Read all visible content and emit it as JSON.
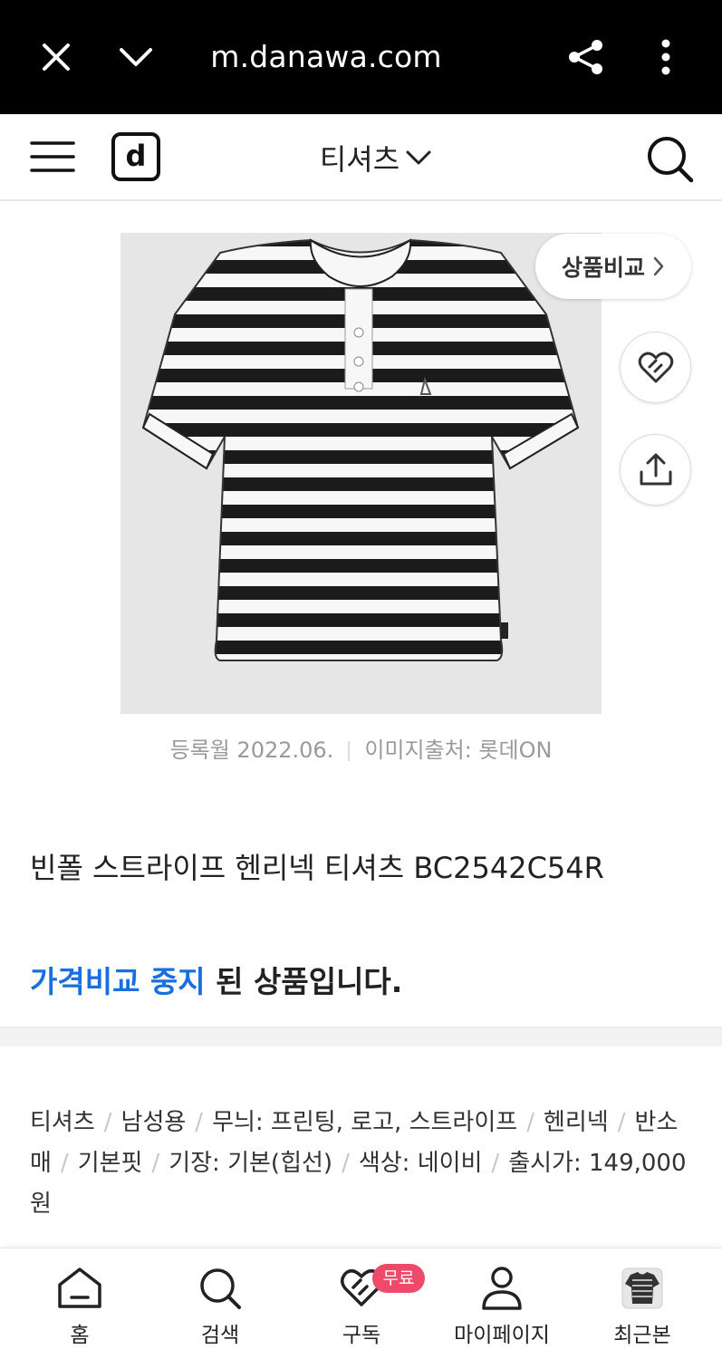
{
  "browser": {
    "url": "m.danawa.com",
    "icons": [
      "close-icon",
      "chevron-down-icon",
      "share-icon",
      "more-vertical-icon"
    ]
  },
  "header": {
    "logo": "d",
    "category": "티셔츠",
    "icons": [
      "menu-icon",
      "search-icon"
    ]
  },
  "product": {
    "compare_label": "상품비교",
    "image_date": "등록월 2022.06.",
    "image_source": "이미지출처: 롯데ON",
    "title": "빈폴 스트라이프 헨리넥 티셔츠 BC2542C54R",
    "notice_highlight": "가격비교 중지",
    "notice_rest": " 된 상품입니다.",
    "specs": [
      "티셔츠",
      "남성용",
      "무늬: 프린팅, 로고, 스트라이프",
      "헨리넥",
      "반소매",
      "기본핏",
      "기장: 기본(힙선)",
      "색상: 네이비",
      "출시가: 149,000원"
    ]
  },
  "bottom_nav": {
    "items": [
      {
        "label": "홈",
        "icon": "home-icon"
      },
      {
        "label": "검색",
        "icon": "search-icon"
      },
      {
        "label": "구독",
        "icon": "heart-icon",
        "badge": "무료"
      },
      {
        "label": "마이페이지",
        "icon": "user-icon"
      },
      {
        "label": "최근본",
        "icon": "recent-thumbnail"
      }
    ]
  },
  "colors": {
    "accent_blue": "#1a6fde",
    "badge_pink": "#ee4b6a",
    "browser_bar": "#000000"
  }
}
